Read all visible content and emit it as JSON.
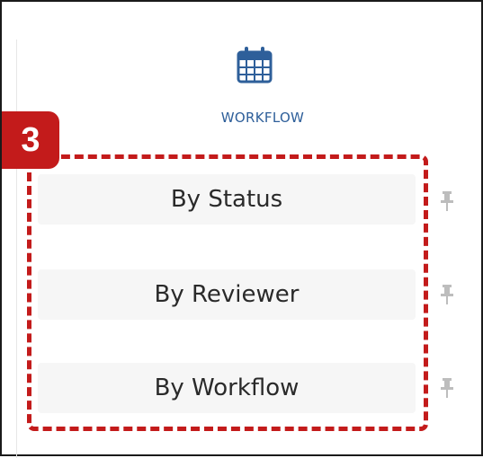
{
  "ribbon": {
    "group_label": "WORKFLOW",
    "icon": "calendar-icon"
  },
  "callout": {
    "step_number": "3",
    "color": "#c31b1b"
  },
  "menu": {
    "items": [
      {
        "label": "By Status",
        "pin_icon": "pin-icon"
      },
      {
        "label": "By Reviewer",
        "pin_icon": "pin-icon"
      },
      {
        "label": "By Workflow",
        "pin_icon": "pin-icon"
      }
    ]
  },
  "colors": {
    "accent": "#2e5f9a",
    "callout": "#c31b1b",
    "item_bg": "#f6f6f6"
  }
}
